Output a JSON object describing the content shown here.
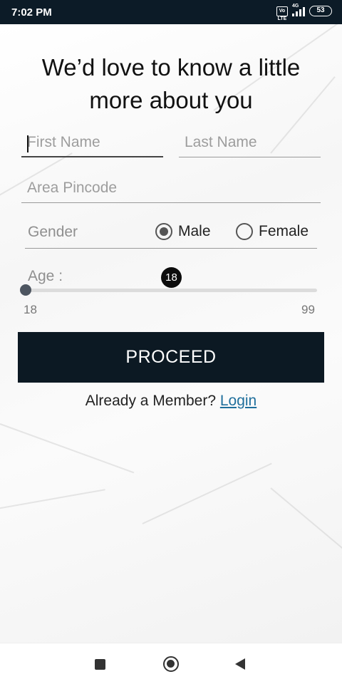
{
  "status_bar": {
    "time": "7:02 PM",
    "volte": "Vo LTE",
    "network": "4G",
    "battery": "53"
  },
  "form": {
    "title_line1": "We’d love to know a little",
    "title_line2": "more about you",
    "first_name": {
      "placeholder": "First Name",
      "value": ""
    },
    "last_name": {
      "placeholder": "Last Name",
      "value": ""
    },
    "pincode": {
      "placeholder": "Area Pincode",
      "value": ""
    },
    "gender": {
      "label": "Gender",
      "options": [
        "Male",
        "Female"
      ],
      "selected": "Male"
    },
    "age": {
      "label": "Age :",
      "current": "18",
      "min": "18",
      "max": "99"
    },
    "proceed_label": "PROCEED",
    "member_text": "Already a Member?",
    "login_label": "Login"
  },
  "navbar": {
    "icons": [
      "recents-icon",
      "home-icon",
      "back-icon"
    ]
  },
  "colors": {
    "status_bar": "#0c1b27",
    "button_bg": "#0c1923",
    "link": "#1f6f9c"
  }
}
